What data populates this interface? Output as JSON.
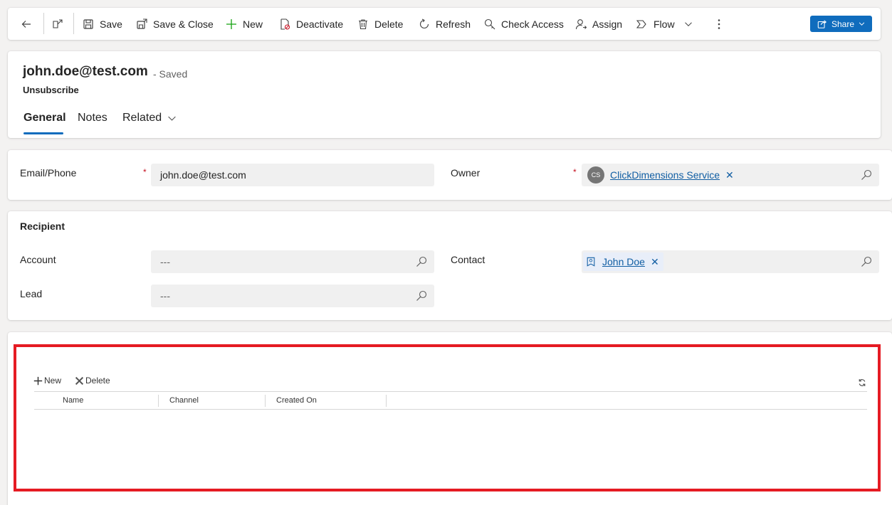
{
  "toolbar": {
    "back_icon": "back-arrow-icon",
    "popout_icon": "open-in-new-window-icon",
    "save": "Save",
    "save_close": "Save & Close",
    "new": "New",
    "deactivate": "Deactivate",
    "delete": "Delete",
    "refresh": "Refresh",
    "check_access": "Check Access",
    "assign": "Assign",
    "flow": "Flow",
    "share": "Share"
  },
  "header": {
    "title": "john.doe@test.com",
    "status": "- Saved",
    "entity": "Unsubscribe",
    "tabs": [
      {
        "label": "General"
      },
      {
        "label": "Notes"
      },
      {
        "label": "Related"
      }
    ]
  },
  "section_main": {
    "email_label": "Email/Phone",
    "email_value": "john.doe@test.com",
    "owner_label": "Owner",
    "owner_initials": "CS",
    "owner_value": "ClickDimensions Service",
    "required_marker": "*"
  },
  "recipient": {
    "title": "Recipient",
    "account_label": "Account",
    "account_value": "---",
    "contact_label": "Contact",
    "contact_value": "John Doe",
    "lead_label": "Lead",
    "lead_value": "---"
  },
  "subgrid": {
    "new": "New",
    "delete": "Delete",
    "columns": [
      "Name",
      "Channel",
      "Created On"
    ]
  },
  "colors": {
    "accent": "#0f6cbd",
    "link": "#115ea3",
    "highlight_border": "#e51b23",
    "required": "#c50f1f"
  }
}
